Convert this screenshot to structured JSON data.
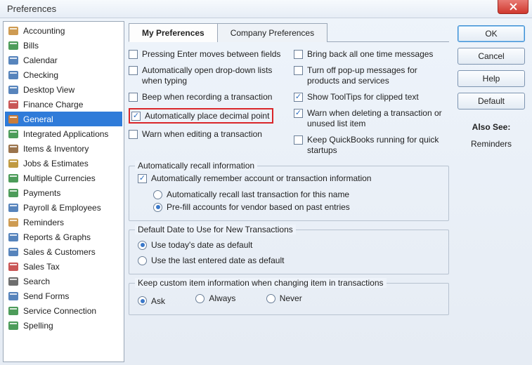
{
  "window": {
    "title": "Preferences"
  },
  "sidebar": {
    "items": [
      {
        "label": "Accounting",
        "icon": "ledger",
        "selected": false
      },
      {
        "label": "Bills",
        "icon": "money",
        "selected": false
      },
      {
        "label": "Calendar",
        "icon": "calendar",
        "selected": false
      },
      {
        "label": "Checking",
        "icon": "check",
        "selected": false
      },
      {
        "label": "Desktop View",
        "icon": "desktop",
        "selected": false
      },
      {
        "label": "Finance Charge",
        "icon": "percent",
        "selected": false
      },
      {
        "label": "General",
        "icon": "gear",
        "selected": true
      },
      {
        "label": "Integrated Applications",
        "icon": "apps",
        "selected": false
      },
      {
        "label": "Items & Inventory",
        "icon": "box",
        "selected": false
      },
      {
        "label": "Jobs & Estimates",
        "icon": "clipboard",
        "selected": false
      },
      {
        "label": "Multiple Currencies",
        "icon": "currency",
        "selected": false
      },
      {
        "label": "Payments",
        "icon": "card",
        "selected": false
      },
      {
        "label": "Payroll & Employees",
        "icon": "people",
        "selected": false
      },
      {
        "label": "Reminders",
        "icon": "bell",
        "selected": false
      },
      {
        "label": "Reports & Graphs",
        "icon": "chart",
        "selected": false
      },
      {
        "label": "Sales & Customers",
        "icon": "cart",
        "selected": false
      },
      {
        "label": "Sales Tax",
        "icon": "tax",
        "selected": false
      },
      {
        "label": "Search",
        "icon": "search",
        "selected": false
      },
      {
        "label": "Send Forms",
        "icon": "mail",
        "selected": false
      },
      {
        "label": "Service Connection",
        "icon": "globe",
        "selected": false
      },
      {
        "label": "Spelling",
        "icon": "abc",
        "selected": false
      }
    ]
  },
  "tabs": {
    "my": "My Preferences",
    "company": "Company Preferences",
    "active": "my"
  },
  "left_checks": [
    {
      "label": "Pressing Enter moves between fields",
      "checked": false
    },
    {
      "label": "Automatically open drop-down lists when typing",
      "checked": false
    },
    {
      "label": "Beep when recording a transaction",
      "checked": false
    },
    {
      "label": "Automatically place decimal point",
      "checked": true,
      "highlight": true
    },
    {
      "label": "Warn when editing a transaction",
      "checked": false
    }
  ],
  "right_checks": [
    {
      "label": "Bring back all one time messages",
      "checked": false
    },
    {
      "label": "Turn off pop-up messages for products and services",
      "checked": false
    },
    {
      "label": "Show ToolTips for clipped text",
      "checked": true
    },
    {
      "label": "Warn when deleting a transaction or unused list item",
      "checked": true
    },
    {
      "label": "Keep QuickBooks running for quick startups",
      "checked": false
    }
  ],
  "recall_group": {
    "legend": "Automatically recall information",
    "remember": {
      "label": "Automatically remember account or transaction information",
      "checked": true
    },
    "radios": [
      {
        "label": "Automatically recall last transaction for this name",
        "checked": false
      },
      {
        "label": "Pre-fill accounts for vendor based on past entries",
        "checked": true
      }
    ]
  },
  "date_group": {
    "legend": "Default Date to Use for New Transactions",
    "radios": [
      {
        "label": "Use today's date as default",
        "checked": true
      },
      {
        "label": "Use the last entered date as default",
        "checked": false
      }
    ]
  },
  "keep_group": {
    "legend": "Keep custom item information when changing item in transactions",
    "radios": [
      {
        "label": "Ask",
        "checked": true
      },
      {
        "label": "Always",
        "checked": false
      },
      {
        "label": "Never",
        "checked": false
      }
    ]
  },
  "buttons": {
    "ok": "OK",
    "cancel": "Cancel",
    "help": "Help",
    "default": "Default"
  },
  "also_see": {
    "heading": "Also See:",
    "items": [
      "Reminders"
    ]
  }
}
